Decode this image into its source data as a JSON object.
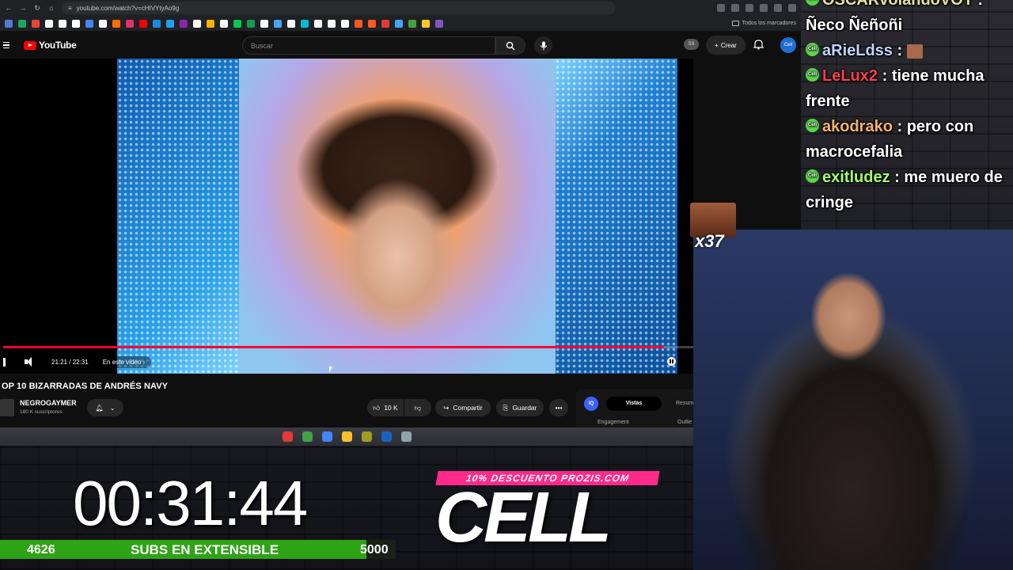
{
  "browser": {
    "url": "youtube.com/watch?v=cHIVYtyAo9g",
    "bookmarks_folder_label": "Todos los marcadores",
    "bookmark_colors": [
      "#4e7bd9",
      "#1fa463",
      "#ea4335",
      "#ffffff",
      "#ffffff",
      "#ffffff",
      "#4285f4",
      "#ffffff",
      "#ff6d00",
      "#e1306c",
      "#ff0000",
      "#1e88e5",
      "#1da1f2",
      "#8e24aa",
      "#ffffff",
      "#f4b400",
      "#ffffff",
      "#00c853",
      "#0f9d58",
      "#ffffff",
      "#42a5f5",
      "#ffffff",
      "#00bcd4",
      "#ffffff",
      "#ffffff",
      "#ffffff",
      "#ff5722",
      "#ff5722",
      "#e53935",
      "#42a5f5",
      "#43a047",
      "#ffca28",
      "#7e57c2"
    ]
  },
  "youtube": {
    "logo_text": "YouTube",
    "search_placeholder": "Buscar",
    "badge_ss": "SS",
    "create_label": "Crear",
    "avatar_text": "Cell"
  },
  "video": {
    "progress_fraction": 0.957,
    "time": "21:21 / 22:31",
    "chapter": "En este video",
    "title": "OP 10 BIZARRADAS DE ANDRÉS NAVY",
    "channel_name": "NEGROGAYMER",
    "channel_subs": "180 K suscriptores",
    "likes": "10 K",
    "share_label": "Compartir",
    "save_label": "Guardar"
  },
  "stats_panel": {
    "iq_label": "IQ",
    "tab_views": "Vistas",
    "tab_summary": "Resum",
    "engagement_label": "Engagement",
    "outlier_label": "Outlie"
  },
  "taskbar_colors": [
    "#e53935",
    "#43a047",
    "#4285f4",
    "#fbc02d",
    "#9e9d24",
    "#1565c0",
    "#90a4ae"
  ],
  "chat": {
    "messages": [
      {
        "user": "OSCARvolandoVOY",
        "user_color": "#e6e0a0",
        "text": "Ñeco Ñeñoñi",
        "emote": false
      },
      {
        "user": "aRieLdss",
        "user_color": "#bcd7ff",
        "text": "",
        "emote": true
      },
      {
        "user": "LeLux2",
        "user_color": "#ff3d4d",
        "text": "tiene mucha frente",
        "emote": false
      },
      {
        "user": "akodrako",
        "user_color": "#f2b36b",
        "text": "pero con macrocefalia",
        "emote": false
      },
      {
        "user": "exitludez",
        "user_color": "#a6ff6e",
        "text": "me muero de cringe",
        "emote": false
      }
    ],
    "badge_text": "Cell"
  },
  "emote_combo": {
    "count": "x37"
  },
  "overlay": {
    "timer": "00:31:44",
    "subs_current": "4626",
    "subs_label": "SUBS EN EXTENSIBLE",
    "subs_goal": "5000",
    "subs_fraction": 0.925,
    "promo_text": "10% DESCUENTO PROZIS.COM",
    "brand_logo": "CELL"
  }
}
